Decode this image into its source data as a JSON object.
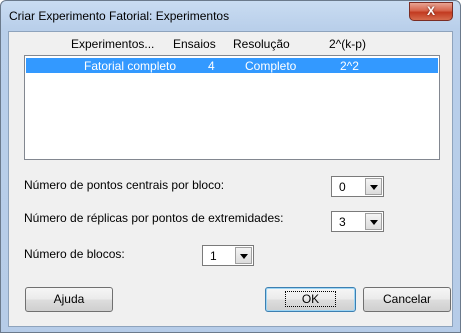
{
  "window": {
    "title": "Criar Experimento Fatorial: Experimentos",
    "close_label": "X"
  },
  "table": {
    "headers": {
      "experiments": "Experimentos...",
      "runs": "Ensaios",
      "resolution": "Resolução",
      "fraction": "2^(k-p)"
    },
    "rows": [
      {
        "design": "Fatorial completo",
        "runs": "4",
        "resolution": "Completo",
        "fraction": "2^2"
      }
    ]
  },
  "center_points": {
    "label": "Número de pontos centrais por bloco:",
    "value": "0"
  },
  "replicates": {
    "label": "Número de réplicas por pontos de extremidades:",
    "value": "3"
  },
  "blocks": {
    "label": "Número de blocos:",
    "value": "1"
  },
  "buttons": {
    "help": "Ajuda",
    "ok": "OK",
    "cancel": "Cancelar"
  }
}
